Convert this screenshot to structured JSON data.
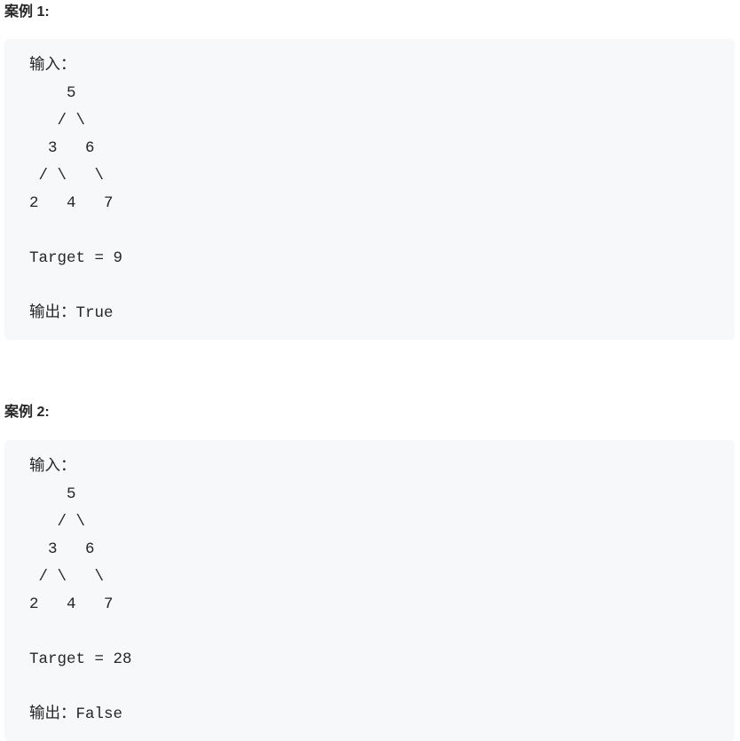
{
  "examples": [
    {
      "title": "案例 1:",
      "lines": [
        "输入：",
        "    5",
        "   / \\",
        "  3   6",
        " / \\   \\",
        "2   4   7",
        "",
        "Target = 9",
        "",
        "输出：True"
      ]
    },
    {
      "title": "案例 2:",
      "lines": [
        "输入：",
        "    5",
        "   / \\",
        "  3   6",
        " / \\   \\",
        "2   4   7",
        "",
        "Target = 28",
        "",
        "输出：False"
      ]
    }
  ]
}
